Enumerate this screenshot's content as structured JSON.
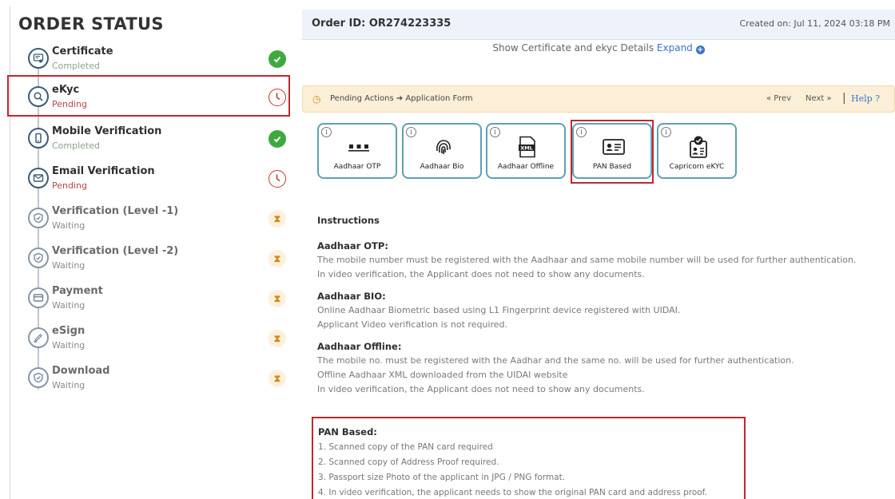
{
  "order_status": {
    "title": "ORDER STATUS",
    "steps": [
      {
        "title": "Certificate",
        "status": "Completed",
        "icon": "certificate-icon",
        "state_icon": "check-icon"
      },
      {
        "title": "eKyc",
        "status": "Pending",
        "icon": "search-icon",
        "state_icon": "clock-icon"
      },
      {
        "title": "Mobile Verification",
        "status": "Completed",
        "icon": "mobile-icon",
        "state_icon": "check-icon"
      },
      {
        "title": "Email Verification",
        "status": "Pending",
        "icon": "mail-icon",
        "state_icon": "clock-icon"
      },
      {
        "title": "Verification (Level -1)",
        "status": "Waiting",
        "icon": "shield-icon",
        "state_icon": "hourglass-icon"
      },
      {
        "title": "Verification (Level -2)",
        "status": "Waiting",
        "icon": "shield-icon",
        "state_icon": "hourglass-icon"
      },
      {
        "title": "Payment",
        "status": "Waiting",
        "icon": "card-icon",
        "state_icon": "hourglass-icon"
      },
      {
        "title": "eSign",
        "status": "Waiting",
        "icon": "pen-icon",
        "state_icon": "hourglass-icon"
      },
      {
        "title": "Download",
        "status": "Waiting",
        "icon": "shield-icon",
        "state_icon": "hourglass-icon"
      }
    ]
  },
  "order": {
    "id_label": "Order ID: OR274223335",
    "created_on": "Created on: Jul 11, 2024 03:18 PM",
    "details_text": "Show Certificate and ekyc Details",
    "expand_label": "Expand"
  },
  "pending_actions": {
    "text": "Pending Actions ➔ Application Form",
    "prev": "« Prev",
    "next": "Next »",
    "help": "Help ?"
  },
  "methods": [
    {
      "label": "Aadhaar OTP",
      "icon": "dots-icon"
    },
    {
      "label": "Aadhaar Bio",
      "icon": "fingerprint-icon"
    },
    {
      "label": "Aadhaar Offline",
      "icon": "xml-file-icon"
    },
    {
      "label": "PAN Based",
      "icon": "id-card-icon"
    },
    {
      "label": "Capricorn eKYC",
      "icon": "verified-id-icon"
    }
  ],
  "instructions": {
    "heading": "Instructions",
    "sections": [
      {
        "title": "Aadhaar OTP:",
        "lines": [
          "The mobile number must be registered with the Aadhaar and same mobile number will be used for further authentication.",
          "In video verification, the Applicant does not need to show any documents."
        ]
      },
      {
        "title": "Aadhaar BIO:",
        "lines": [
          "Online Aadhaar Biometric based using L1 Fingerprint device registered with UIDAI.",
          "Applicant Video verification is not required."
        ]
      },
      {
        "title": "Aadhaar Offline:",
        "lines": [
          "The mobile no. must be registered with the Aadhar and the same no. will be used for further authentication.",
          "Offline Aadhaar XML downloaded from the UIDAI website",
          "In video verification, the Applicant does not need to show any documents."
        ]
      },
      {
        "title": "PAN Based:",
        "lines": [
          "1. Scanned copy of the PAN card required",
          "2. Scanned copy of Address Proof required.",
          "3. Passport size Photo of the applicant in JPG / PNG format.",
          "4. In video verification, the applicant needs to show the original PAN card and address proof."
        ]
      }
    ]
  },
  "colors": {
    "accent": "#3a73c9",
    "highlight": "#c0282f",
    "success": "#3eaa3e",
    "pending": "#c0392b",
    "waiting": "#d08a1f"
  }
}
